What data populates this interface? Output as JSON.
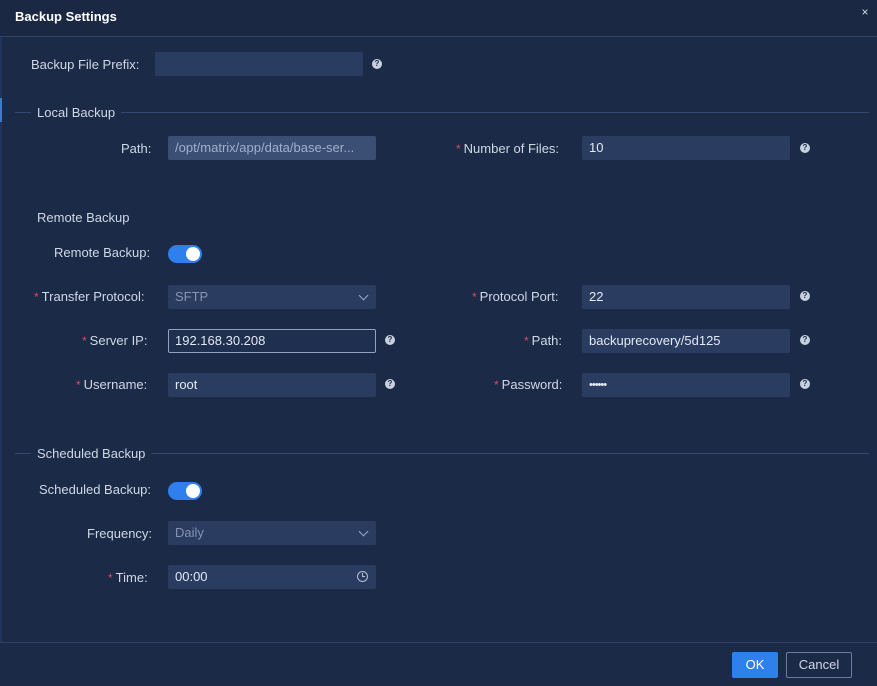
{
  "dialog": {
    "title": "Backup Settings",
    "close_glyph": "×"
  },
  "general": {
    "prefix_label": "Backup File Prefix:",
    "prefix_value": ""
  },
  "local_backup": {
    "section_title": "Local Backup",
    "path_label": "Path:",
    "path_value": "/opt/matrix/app/data/base-ser...",
    "files_label": "Number of Files:",
    "files_value": "10"
  },
  "remote_backup": {
    "section_title": "Remote Backup",
    "toggle_label": "Remote Backup:",
    "enabled": true,
    "protocol_label": "Transfer Protocol:",
    "protocol_value": "SFTP",
    "port_label": "Protocol Port:",
    "port_value": "22",
    "server_ip_label": "Server IP:",
    "server_ip_value": "192.168.30.208",
    "path_label": "Path:",
    "path_value": "backuprecovery/5d125",
    "username_label": "Username:",
    "username_value": "root",
    "password_label": "Password:",
    "password_value": "••••••"
  },
  "scheduled_backup": {
    "section_title": "Scheduled Backup",
    "toggle_label": "Scheduled Backup:",
    "enabled": true,
    "frequency_label": "Frequency:",
    "frequency_value": "Daily",
    "time_label": "Time:",
    "time_value": "00:00"
  },
  "common": {
    "required_mark": "*",
    "help_glyph": "?"
  },
  "footer": {
    "ok_label": "OK",
    "cancel_label": "Cancel"
  },
  "colors": {
    "background": "#1b2a46",
    "input": "#2a3d61",
    "accent": "#2f80ed",
    "required": "#e0485a"
  }
}
